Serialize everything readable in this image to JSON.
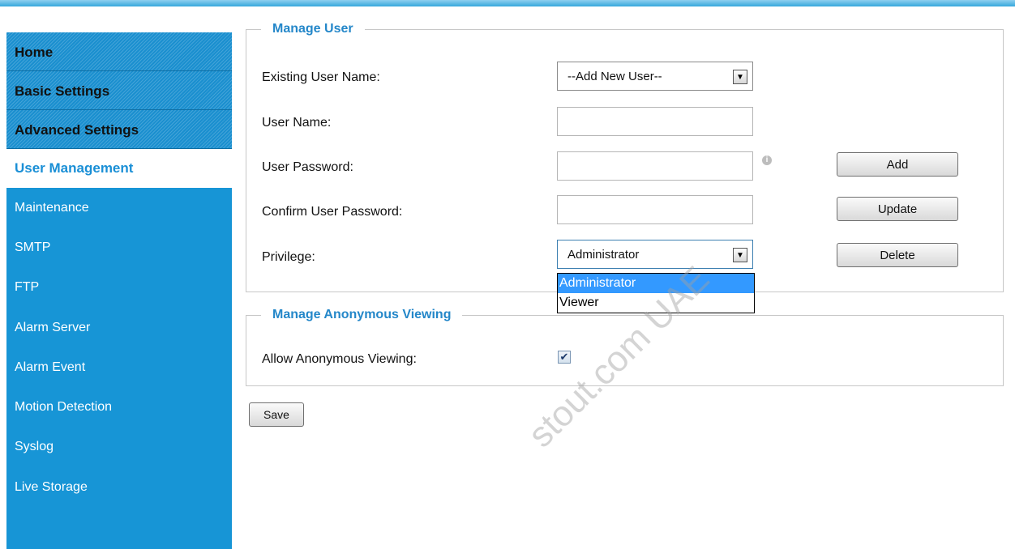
{
  "sidebar": {
    "top_items": [
      "Home",
      "Basic Settings",
      "Advanced Settings"
    ],
    "active_item": "User Management",
    "items": [
      "Maintenance",
      "SMTP",
      "FTP",
      "Alarm Server",
      "Alarm Event",
      "Motion Detection",
      "Syslog",
      "Live Storage"
    ]
  },
  "manage_user": {
    "legend": "Manage User",
    "existing_user_label": "Existing User Name:",
    "existing_user_value": "--Add New User--",
    "user_name_label": "User Name:",
    "user_name_value": "",
    "password_label": "User Password:",
    "password_value": "",
    "confirm_label": "Confirm User Password:",
    "confirm_value": "",
    "privilege_label": "Privilege:",
    "privilege_value": "Administrator",
    "privilege_options": [
      "Administrator",
      "Viewer"
    ],
    "add_label": "Add",
    "update_label": "Update",
    "delete_label": "Delete",
    "info_icon": "info-icon"
  },
  "anonymous": {
    "legend": "Manage Anonymous Viewing",
    "allow_label": "Allow Anonymous Viewing:",
    "allow_checked": true
  },
  "save_label": "Save",
  "watermark": "stout.com UAE",
  "colors": {
    "sidebar_bg": "#1795d6",
    "accent": "#2487c9",
    "dropdown_selected": "#3399ff"
  }
}
